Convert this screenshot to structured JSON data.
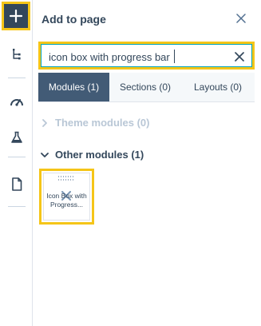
{
  "panel": {
    "title": "Add to page"
  },
  "search": {
    "value": "icon box with progress bar"
  },
  "tabs": [
    {
      "label": "Modules (1)",
      "active": true
    },
    {
      "label": "Sections (0)",
      "active": false
    },
    {
      "label": "Layouts (0)",
      "active": false
    }
  ],
  "groups": [
    {
      "label": "Theme modules (0)",
      "expanded": false
    },
    {
      "label": "Other modules (1)",
      "expanded": true
    }
  ],
  "modules": [
    {
      "label": "Icon Box with Progress..."
    }
  ],
  "rail": {
    "icons": [
      "plus-icon",
      "tree-icon",
      "gauge-icon",
      "flask-icon",
      "page-icon"
    ]
  },
  "colors": {
    "highlight": "#f5c518",
    "dark": "#33475b",
    "active_tab": "#425b76",
    "focus_border": "#00a4bd",
    "muted": "#b9c7d6"
  }
}
